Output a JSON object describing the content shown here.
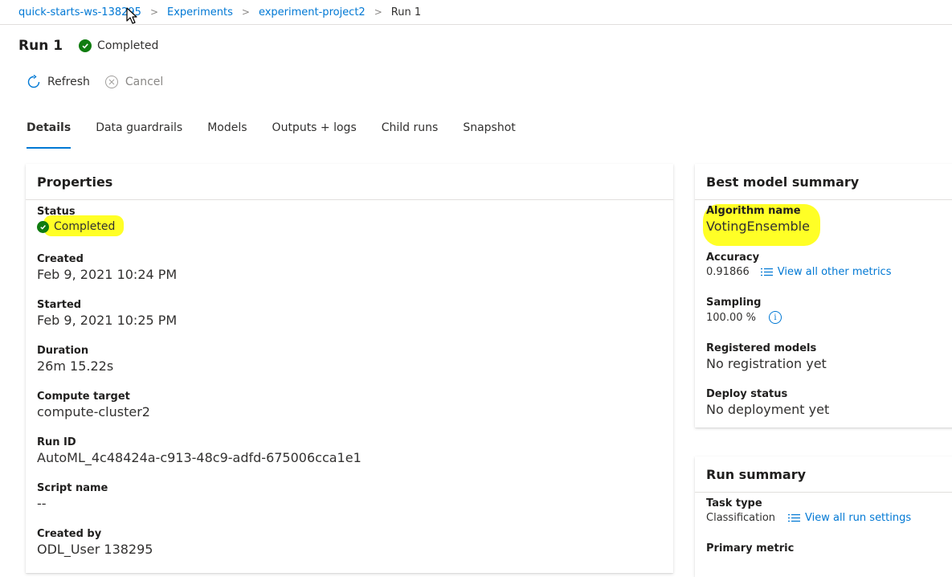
{
  "breadcrumb": [
    {
      "label": "quick-starts-ws-138295"
    },
    {
      "label": "Experiments"
    },
    {
      "label": "experiment-project2"
    },
    {
      "label": "Run 1"
    }
  ],
  "header": {
    "title": "Run 1",
    "status": "Completed"
  },
  "toolbar": {
    "refresh_label": "Refresh",
    "cancel_label": "Cancel"
  },
  "tabs": [
    {
      "label": "Details",
      "active": true
    },
    {
      "label": "Data guardrails"
    },
    {
      "label": "Models"
    },
    {
      "label": "Outputs + logs"
    },
    {
      "label": "Child runs"
    },
    {
      "label": "Snapshot"
    }
  ],
  "properties": {
    "title": "Properties",
    "status_label": "Status",
    "status_value": "Completed",
    "created_label": "Created",
    "created_value": "Feb 9, 2021 10:24 PM",
    "started_label": "Started",
    "started_value": "Feb 9, 2021 10:25 PM",
    "duration_label": "Duration",
    "duration_value": "26m 15.22s",
    "compute_label": "Compute target",
    "compute_value": "compute-cluster2",
    "runid_label": "Run ID",
    "runid_value": "AutoML_4c48424a-c913-48c9-adfd-675006cca1e1",
    "script_label": "Script name",
    "script_value": "--",
    "createdby_label": "Created by",
    "createdby_value": "ODL_User 138295"
  },
  "best_model": {
    "title": "Best model summary",
    "algorithm_label": "Algorithm name",
    "algorithm_value": "VotingEnsemble",
    "accuracy_label": "Accuracy",
    "accuracy_value": "0.91866",
    "metrics_link": "View all other metrics",
    "sampling_label": "Sampling",
    "sampling_value": "100.00 %",
    "registered_label": "Registered models",
    "registered_value": "No registration yet",
    "deploy_label": "Deploy status",
    "deploy_value": "No deployment yet"
  },
  "run_summary": {
    "title": "Run summary",
    "task_label": "Task type",
    "task_value": "Classification",
    "settings_link": "View all run settings",
    "metric_label": "Primary metric"
  },
  "colors": {
    "accent": "#0078d4",
    "success": "#107c10",
    "highlight": "#ffff00"
  }
}
